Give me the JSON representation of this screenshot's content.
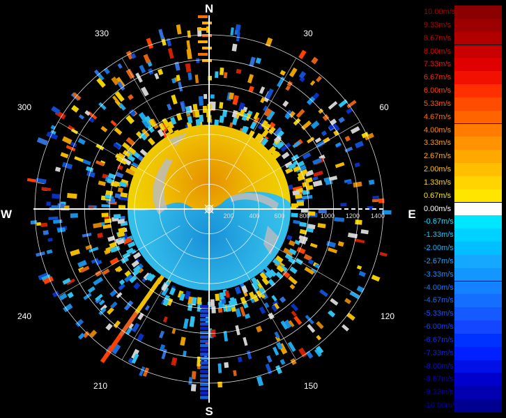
{
  "chart_data": {
    "type": "polar-velocity-display",
    "compass": {
      "north": "N",
      "east": "E",
      "south": "S",
      "west": "W"
    },
    "azimuth_labels": [
      "30",
      "60",
      "120",
      "150",
      "210",
      "240",
      "300",
      "330"
    ],
    "range_labels": [
      "200",
      "400",
      "600",
      "800",
      "1000",
      "1200",
      "1400"
    ],
    "ring_values": [
      200,
      400,
      600,
      800,
      1000,
      1200,
      1400
    ],
    "max_range": 1400,
    "legend": {
      "labels": [
        "10.00m/s",
        "9.33m/s",
        "8.67m/s",
        "8.00m/s",
        "7.33m/s",
        "6.67m/s",
        "6.00m/s",
        "5.33m/s",
        "4.67m/s",
        "4.00m/s",
        "3.33m/s",
        "2.67m/s",
        "2.00m/s",
        "1.33m/s",
        "0.67m/s",
        "0.00m/s",
        "-0.67m/s",
        "-1.33m/s",
        "-2.00m/s",
        "-2.67m/s",
        "-3.33m/s",
        "-4.00m/s",
        "-4.67m/s",
        "-5.33m/s",
        "-6.00m/s",
        "-6.67m/s",
        "-7.33m/s",
        "-8.00m/s",
        "-8.67m/s",
        "-9.33m/s",
        "-10.00m/s"
      ],
      "swatch_colors": [
        "#8b0000",
        "#9d0000",
        "#b20000",
        "#c80000",
        "#e00000",
        "#f21000",
        "#ff3000",
        "#ff4c00",
        "#ff6400",
        "#ff7c00",
        "#ff9200",
        "#ffa800",
        "#ffbe00",
        "#ffd400",
        "#ffe600",
        "#ffffff",
        "#00e6ff",
        "#00d2ff",
        "#00beff",
        "#14a8ff",
        "#1496ff",
        "#1482ff",
        "#146eff",
        "#145aff",
        "#1446ff",
        "#0032ff",
        "#0020ff",
        "#0010e6",
        "#0000cc",
        "#0000b0",
        "#000090"
      ],
      "label_colors": [
        "#a00000",
        "#b40000",
        "#c80000",
        "#dc0000",
        "#ee1010",
        "#ff2a00",
        "#ff4200",
        "#ff5a00",
        "#ff7000",
        "#ff8800",
        "#ff9c00",
        "#ffb000",
        "#ffc400",
        "#ffd800",
        "#ffe800",
        "#ffffff",
        "#10e0ff",
        "#10ccff",
        "#10b8ff",
        "#14a4ff",
        "#1490ff",
        "#147cff",
        "#1468ff",
        "#1454ff",
        "#1440ff",
        "#1030f0",
        "#1020e0",
        "#1010d0",
        "#1000c0",
        "#0a00b0",
        "#0800a0"
      ]
    },
    "colors": {
      "positive": "#f0d000",
      "positive_core": "#e69000",
      "negative": "#30b8e8",
      "negative_deep": "#1490d8",
      "zero": "#bcbcbc",
      "grid": "#ffffff",
      "background": "#000000"
    }
  }
}
